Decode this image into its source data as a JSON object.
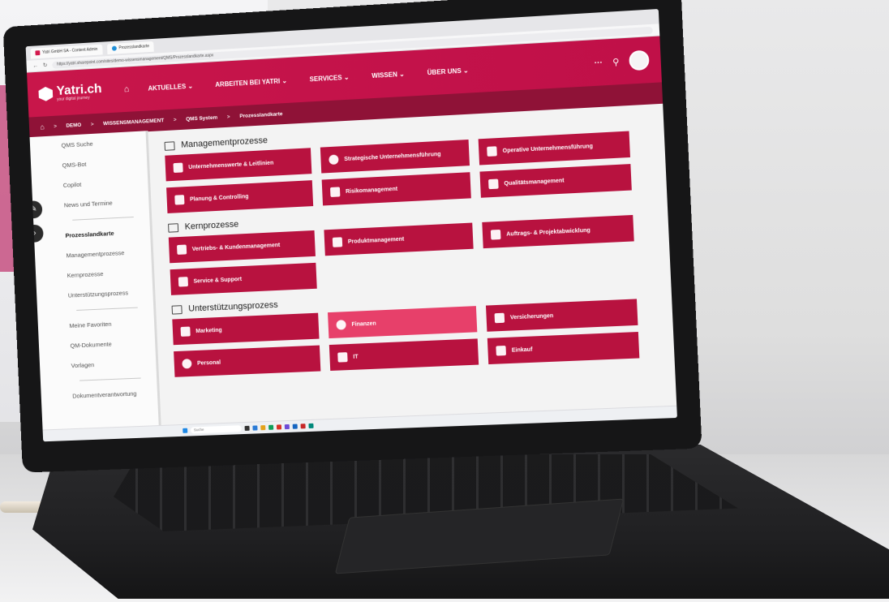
{
  "browser": {
    "tabs": [
      {
        "label": "Yatri GmbH SA - Content Admin"
      },
      {
        "label": "Prozesslandkarte"
      }
    ],
    "url": "https://yatri.sharepoint.com/sites/demo-wissensmanagement/QMS/Prozesslandkarte.aspx"
  },
  "header": {
    "logo_text": "Yatri.ch",
    "logo_tagline": "your digital journey",
    "nav": [
      "AKTUELLES ⌄",
      "ARBEITEN BEI YATRI ⌄",
      "SERVICES ⌄",
      "WISSEN ⌄",
      "ÜBER UNS ⌄"
    ],
    "more": "···",
    "brand_color": "#c8164a"
  },
  "breadcrumb": [
    "DEMO",
    "WISSENSMANAGEMENT",
    "QMS System",
    "Prozesslandkarte"
  ],
  "sidebar": {
    "top": [
      "QMS Suche",
      "QMS-Bot",
      "Copilot",
      "News und Termine"
    ],
    "middle": [
      "Prozesslandkarte",
      "Managementprozesse",
      "Kernprozesse",
      "Unterstützungsprozess"
    ],
    "bottom": [
      "Meine Favoriten",
      "QM-Dokumente",
      "Vorlagen"
    ],
    "footer": [
      "Dokumentverantwortung"
    ]
  },
  "sections": [
    {
      "title": "Managementprozesse",
      "tiles": [
        {
          "label": "Unternehmenswerte & Leitlinien",
          "icon": "gears-icon"
        },
        {
          "label": "Strategische Unternehmensführung",
          "icon": "target-icon"
        },
        {
          "label": "Operative Unternehmensführung",
          "icon": "cogs-icon"
        },
        {
          "label": "Planung & Controlling",
          "icon": "gauge-icon"
        },
        {
          "label": "Risikomanagement",
          "icon": "lightning-icon"
        },
        {
          "label": "Qualitätsmanagement",
          "icon": "certificate-icon"
        }
      ]
    },
    {
      "title": "Kernprozesse",
      "tiles": [
        {
          "label": "Vertriebs- & Kundenmanagement",
          "icon": "coins-icon"
        },
        {
          "label": "Produktmanagement",
          "icon": "boxes-icon"
        },
        {
          "label": "Auftrags- & Projektabwicklung",
          "icon": "tasks-icon"
        },
        {
          "label": "Service & Support",
          "icon": "tools-icon"
        }
      ]
    },
    {
      "title": "Unterstützungsprozess",
      "tiles": [
        {
          "label": "Marketing",
          "icon": "megaphone-icon"
        },
        {
          "label": "Finanzen",
          "icon": "coin-icon",
          "highlight": true
        },
        {
          "label": "Versicherungen",
          "icon": "shield-card-icon"
        },
        {
          "label": "Personal",
          "icon": "people-icon"
        },
        {
          "label": "IT",
          "icon": "computer-icon"
        },
        {
          "label": "Einkauf",
          "icon": "cart-icon"
        }
      ]
    }
  ],
  "taskbar": {
    "search_placeholder": "Suche"
  }
}
